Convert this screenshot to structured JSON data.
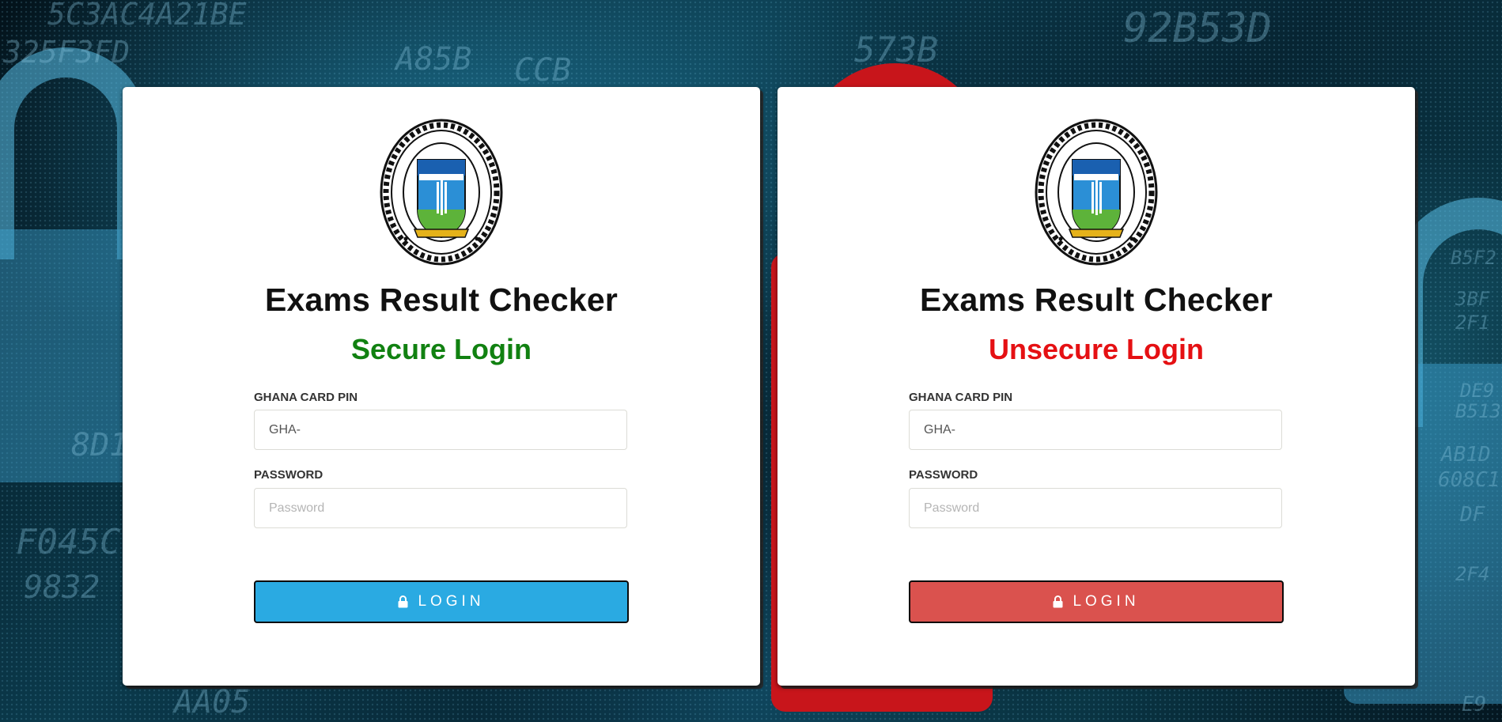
{
  "theme": {
    "secure_color": "#118111",
    "unsecure_color": "#e51013",
    "secure_button_color": "#2aaae2",
    "unsecure_button_color": "#da524e"
  },
  "logo": {
    "ring_text": "GHANA INSTITUTE OF MANAGEMENT AND PUBLIC ADMINISTRATION",
    "motto": "EXCELLENCE",
    "location": "GREEN HILL",
    "icon": "gimpa-crest-logo"
  },
  "background_text": [
    "5C3AC4A21BE",
    "325F3FD",
    "A85B",
    "CCB",
    "573B",
    "92B53D",
    "8D1",
    "F045C",
    "9832",
    "AA05",
    "B5F2",
    "3BF",
    "2F1",
    "DE9",
    "B513",
    "AB1D",
    "608C1",
    "DF",
    "2F4",
    "E9"
  ],
  "cards": [
    {
      "title": "Exams Result Checker",
      "subtitle": "Secure Login",
      "pin_label": "GHANA CARD PIN",
      "pin_value": "GHA-",
      "password_label": "PASSWORD",
      "password_placeholder": "Password",
      "button_label": "LOGIN",
      "button_icon": "lock-icon"
    },
    {
      "title": "Exams Result Checker",
      "subtitle": "Unsecure Login",
      "pin_label": "GHANA CARD PIN",
      "pin_value": "GHA-",
      "password_label": "PASSWORD",
      "password_placeholder": "Password",
      "button_label": "LOGIN",
      "button_icon": "lock-icon"
    }
  ]
}
